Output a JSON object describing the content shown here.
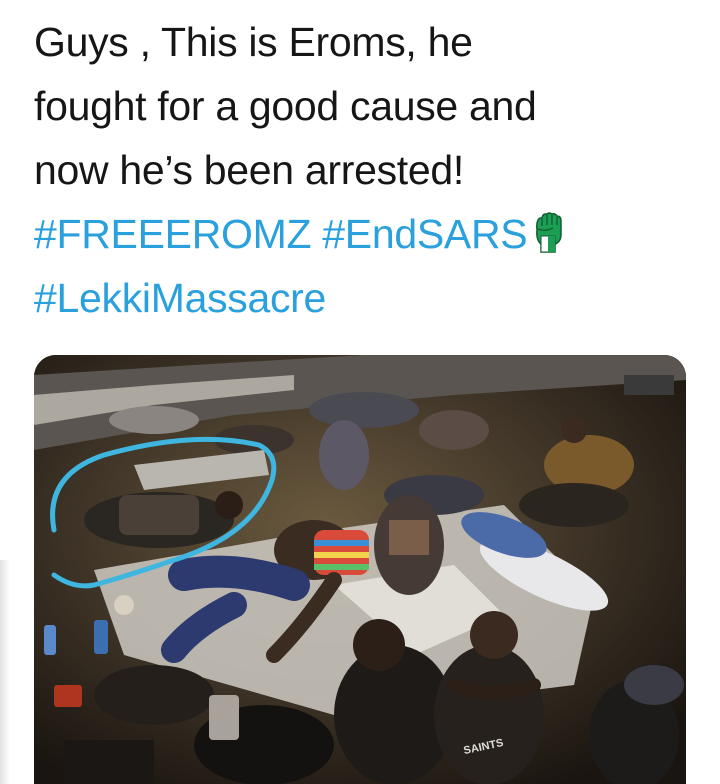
{
  "tweet": {
    "line1": "Guys , This is Eroms, he",
    "line2": "fought for a good cause and",
    "line3": "now he’s been arrested!",
    "hashtags": {
      "freeeromz": "#FREEEROMZ",
      "endsars": "#EndSARS",
      "lekki": "#LekkiMassacre"
    },
    "emoji": "raised-fist-icon"
  },
  "photo": {
    "shirt_text": "SAINTS"
  },
  "colors": {
    "text": "#161616",
    "hashtag": "#2aa0dd",
    "highlight_circle": "#3fb6e0"
  }
}
